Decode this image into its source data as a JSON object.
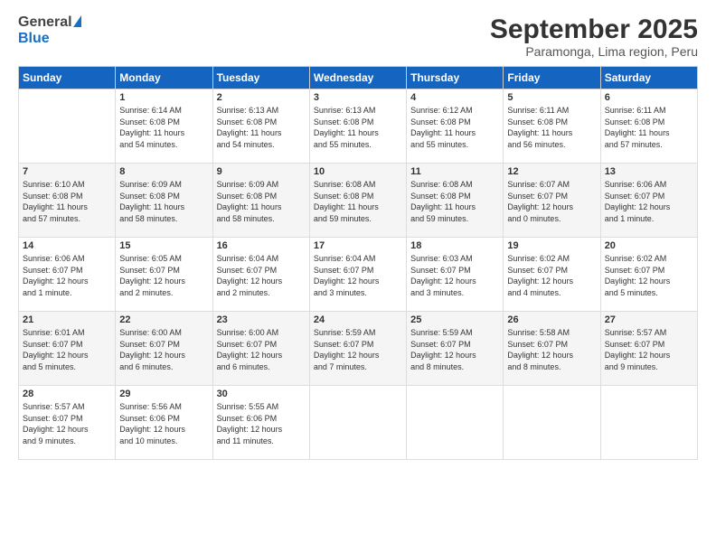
{
  "header": {
    "logo_general": "General",
    "logo_blue": "Blue",
    "title": "September 2025",
    "location": "Paramonga, Lima region, Peru"
  },
  "days_of_week": [
    "Sunday",
    "Monday",
    "Tuesday",
    "Wednesday",
    "Thursday",
    "Friday",
    "Saturday"
  ],
  "weeks": [
    [
      {
        "day": "",
        "content": ""
      },
      {
        "day": "1",
        "content": "Sunrise: 6:14 AM\nSunset: 6:08 PM\nDaylight: 11 hours\nand 54 minutes."
      },
      {
        "day": "2",
        "content": "Sunrise: 6:13 AM\nSunset: 6:08 PM\nDaylight: 11 hours\nand 54 minutes."
      },
      {
        "day": "3",
        "content": "Sunrise: 6:13 AM\nSunset: 6:08 PM\nDaylight: 11 hours\nand 55 minutes."
      },
      {
        "day": "4",
        "content": "Sunrise: 6:12 AM\nSunset: 6:08 PM\nDaylight: 11 hours\nand 55 minutes."
      },
      {
        "day": "5",
        "content": "Sunrise: 6:11 AM\nSunset: 6:08 PM\nDaylight: 11 hours\nand 56 minutes."
      },
      {
        "day": "6",
        "content": "Sunrise: 6:11 AM\nSunset: 6:08 PM\nDaylight: 11 hours\nand 57 minutes."
      }
    ],
    [
      {
        "day": "7",
        "content": "Sunrise: 6:10 AM\nSunset: 6:08 PM\nDaylight: 11 hours\nand 57 minutes."
      },
      {
        "day": "8",
        "content": "Sunrise: 6:09 AM\nSunset: 6:08 PM\nDaylight: 11 hours\nand 58 minutes."
      },
      {
        "day": "9",
        "content": "Sunrise: 6:09 AM\nSunset: 6:08 PM\nDaylight: 11 hours\nand 58 minutes."
      },
      {
        "day": "10",
        "content": "Sunrise: 6:08 AM\nSunset: 6:08 PM\nDaylight: 11 hours\nand 59 minutes."
      },
      {
        "day": "11",
        "content": "Sunrise: 6:08 AM\nSunset: 6:08 PM\nDaylight: 11 hours\nand 59 minutes."
      },
      {
        "day": "12",
        "content": "Sunrise: 6:07 AM\nSunset: 6:07 PM\nDaylight: 12 hours\nand 0 minutes."
      },
      {
        "day": "13",
        "content": "Sunrise: 6:06 AM\nSunset: 6:07 PM\nDaylight: 12 hours\nand 1 minute."
      }
    ],
    [
      {
        "day": "14",
        "content": "Sunrise: 6:06 AM\nSunset: 6:07 PM\nDaylight: 12 hours\nand 1 minute."
      },
      {
        "day": "15",
        "content": "Sunrise: 6:05 AM\nSunset: 6:07 PM\nDaylight: 12 hours\nand 2 minutes."
      },
      {
        "day": "16",
        "content": "Sunrise: 6:04 AM\nSunset: 6:07 PM\nDaylight: 12 hours\nand 2 minutes."
      },
      {
        "day": "17",
        "content": "Sunrise: 6:04 AM\nSunset: 6:07 PM\nDaylight: 12 hours\nand 3 minutes."
      },
      {
        "day": "18",
        "content": "Sunrise: 6:03 AM\nSunset: 6:07 PM\nDaylight: 12 hours\nand 3 minutes."
      },
      {
        "day": "19",
        "content": "Sunrise: 6:02 AM\nSunset: 6:07 PM\nDaylight: 12 hours\nand 4 minutes."
      },
      {
        "day": "20",
        "content": "Sunrise: 6:02 AM\nSunset: 6:07 PM\nDaylight: 12 hours\nand 5 minutes."
      }
    ],
    [
      {
        "day": "21",
        "content": "Sunrise: 6:01 AM\nSunset: 6:07 PM\nDaylight: 12 hours\nand 5 minutes."
      },
      {
        "day": "22",
        "content": "Sunrise: 6:00 AM\nSunset: 6:07 PM\nDaylight: 12 hours\nand 6 minutes."
      },
      {
        "day": "23",
        "content": "Sunrise: 6:00 AM\nSunset: 6:07 PM\nDaylight: 12 hours\nand 6 minutes."
      },
      {
        "day": "24",
        "content": "Sunrise: 5:59 AM\nSunset: 6:07 PM\nDaylight: 12 hours\nand 7 minutes."
      },
      {
        "day": "25",
        "content": "Sunrise: 5:59 AM\nSunset: 6:07 PM\nDaylight: 12 hours\nand 8 minutes."
      },
      {
        "day": "26",
        "content": "Sunrise: 5:58 AM\nSunset: 6:07 PM\nDaylight: 12 hours\nand 8 minutes."
      },
      {
        "day": "27",
        "content": "Sunrise: 5:57 AM\nSunset: 6:07 PM\nDaylight: 12 hours\nand 9 minutes."
      }
    ],
    [
      {
        "day": "28",
        "content": "Sunrise: 5:57 AM\nSunset: 6:07 PM\nDaylight: 12 hours\nand 9 minutes."
      },
      {
        "day": "29",
        "content": "Sunrise: 5:56 AM\nSunset: 6:06 PM\nDaylight: 12 hours\nand 10 minutes."
      },
      {
        "day": "30",
        "content": "Sunrise: 5:55 AM\nSunset: 6:06 PM\nDaylight: 12 hours\nand 11 minutes."
      },
      {
        "day": "",
        "content": ""
      },
      {
        "day": "",
        "content": ""
      },
      {
        "day": "",
        "content": ""
      },
      {
        "day": "",
        "content": ""
      }
    ]
  ]
}
